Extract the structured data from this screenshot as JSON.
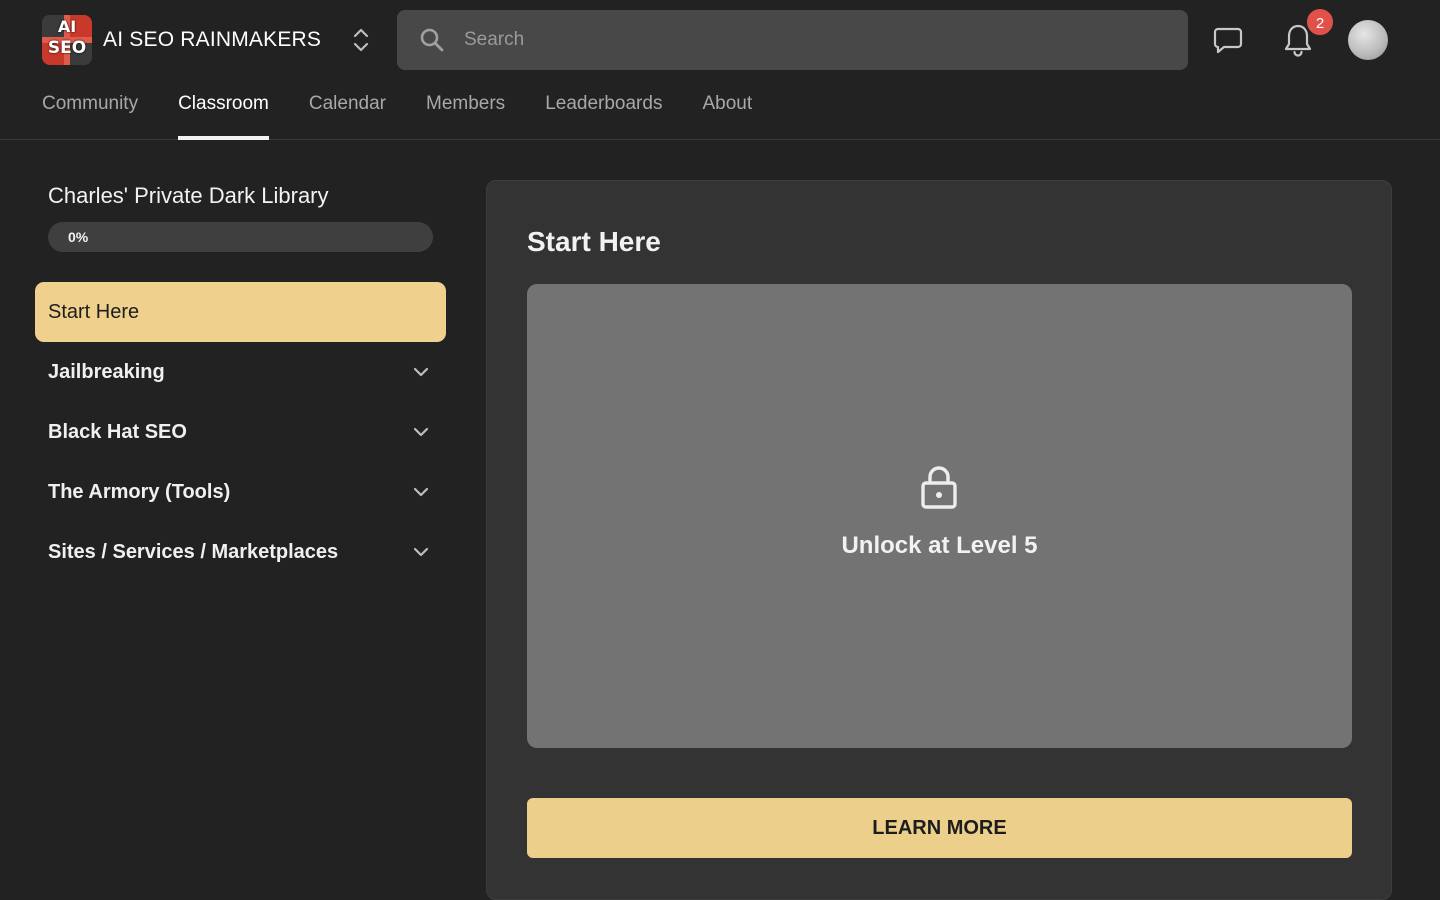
{
  "header": {
    "logo_line1": "AI",
    "logo_line2": "SEO",
    "brand_name": "AI SEO RAINMAKERS",
    "search_placeholder": "Search",
    "notification_count": "2",
    "icons": [
      "group-switcher-icon",
      "search-icon",
      "chat-icon",
      "bell-icon",
      "avatar"
    ]
  },
  "tabs": [
    {
      "label": "Community",
      "active": false
    },
    {
      "label": "Classroom",
      "active": true
    },
    {
      "label": "Calendar",
      "active": false
    },
    {
      "label": "Members",
      "active": false
    },
    {
      "label": "Leaderboards",
      "active": false
    },
    {
      "label": "About",
      "active": false
    }
  ],
  "sidebar": {
    "course_title": "Charles' Private Dark Library",
    "progress_percent": 0,
    "progress_label": "0%",
    "modules": [
      {
        "label": "Start Here",
        "active": true,
        "expandable": false
      },
      {
        "label": "Jailbreaking",
        "active": false,
        "expandable": true
      },
      {
        "label": "Black Hat SEO",
        "active": false,
        "expandable": true
      },
      {
        "label": "The Armory (Tools)",
        "active": false,
        "expandable": true
      },
      {
        "label": "Sites / Services / Marketplaces",
        "active": false,
        "expandable": true
      }
    ]
  },
  "main": {
    "title": "Start Here",
    "lock_message": "Unlock at Level 5",
    "learn_more_label": "LEARN MORE"
  },
  "colors": {
    "background": "#222222",
    "panel": "#333333",
    "accent": "#eccf8a",
    "locked_area": "#737373",
    "badge": "#e0514a"
  }
}
